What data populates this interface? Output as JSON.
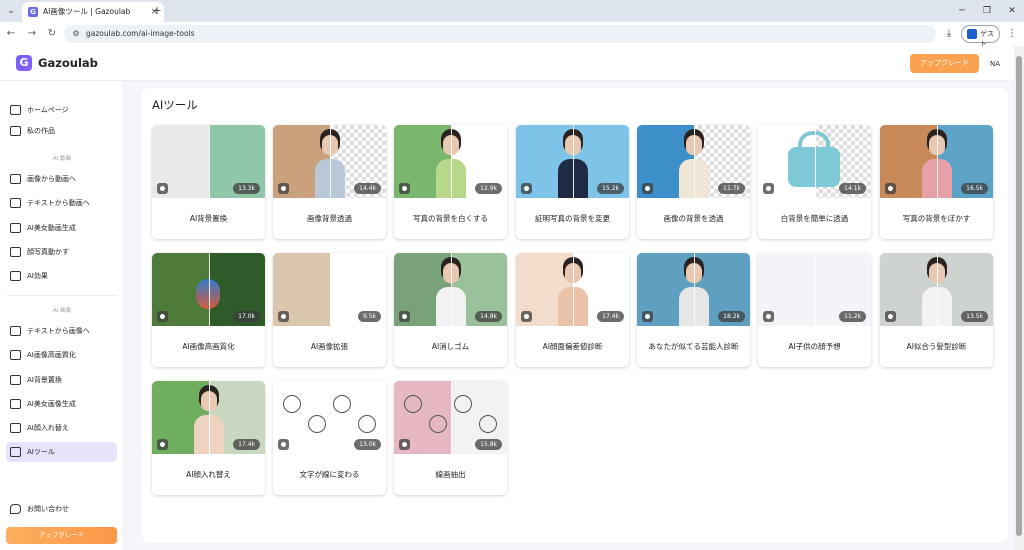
{
  "browser": {
    "tab_title": "AI画像ツール | Gazoulab",
    "tab_favicon": "G",
    "url": "gazoulab.com/ai-image-tools",
    "guest_label": "ゲスト"
  },
  "header": {
    "logo_mark": "G",
    "logo_text": "Gazoulab",
    "upgrade_label": "アップグレード",
    "avatar_initials": "NA"
  },
  "sidebar": {
    "top_items": [
      {
        "label": "ホームページ",
        "icon": "home-icon"
      },
      {
        "label": "私の作品",
        "icon": "folder-icon"
      }
    ],
    "video_section": "AI 動画",
    "video_items": [
      {
        "label": "画像から動画へ",
        "icon": "image-video-icon"
      },
      {
        "label": "テキストから動画へ",
        "icon": "text-video-icon"
      },
      {
        "label": "AI美女動画生成",
        "icon": "beauty-video-icon"
      },
      {
        "label": "顔写真動かす",
        "icon": "face-animate-icon"
      },
      {
        "label": "AI効果",
        "icon": "effect-icon"
      }
    ],
    "image_section": "AI 画像",
    "image_items": [
      {
        "label": "テキストから画像へ",
        "icon": "text-image-icon"
      },
      {
        "label": "AI画像高画質化",
        "icon": "enhance-icon"
      },
      {
        "label": "AI背景置換",
        "icon": "background-icon"
      },
      {
        "label": "AI美女画像生成",
        "icon": "beauty-image-icon"
      },
      {
        "label": "AI顔入れ替え",
        "icon": "faceswap-icon"
      },
      {
        "label": "AIツール",
        "icon": "toolbox-icon",
        "active": true
      }
    ],
    "contact_label": "お問い合わせ",
    "upgrade_label": "アップグレード"
  },
  "main": {
    "title": "AIツール",
    "tools": [
      {
        "label": "AI背景置換",
        "count": "13.3k"
      },
      {
        "label": "画像背景透過",
        "count": "14.4k"
      },
      {
        "label": "写真の背景を白くする",
        "count": "12.9k"
      },
      {
        "label": "証明写真の背景を変更",
        "count": "15.2k"
      },
      {
        "label": "画像の背景を透過",
        "count": "11.7k"
      },
      {
        "label": "白背景を簡単に透過",
        "count": "14.1k"
      },
      {
        "label": "写真の背景をぼかす",
        "count": "16.5k"
      },
      {
        "label": "AI画像高画質化",
        "count": "17.0k"
      },
      {
        "label": "AI画像拡張",
        "count": "9.5k"
      },
      {
        "label": "AI消しゴム",
        "count": "14.8k"
      },
      {
        "label": "AI顔面偏差値診断",
        "count": "17.4k"
      },
      {
        "label": "あなたが似てる芸能人診断",
        "count": "18.2k"
      },
      {
        "label": "AI子供の顔予想",
        "count": "11.2k"
      },
      {
        "label": "AI似合う髪型診断",
        "count": "13.5k"
      },
      {
        "label": "AI顔入れ替え",
        "count": "17.4k"
      },
      {
        "label": "文字が線に変わる",
        "count": "13.0k"
      },
      {
        "label": "線画抽出",
        "count": "15.8k"
      }
    ]
  },
  "colors": {
    "accent": "#fba250",
    "brand": "#6c63ff",
    "active_bg": "#e6e3fb"
  }
}
